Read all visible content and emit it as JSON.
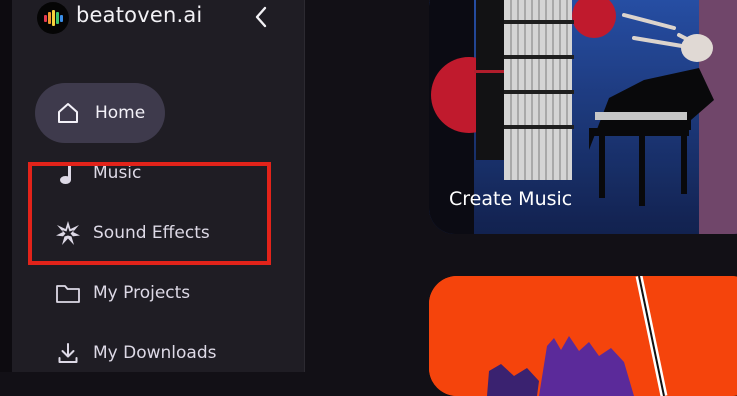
{
  "brand": {
    "name": "beatoven.ai"
  },
  "sidebar": {
    "items": [
      {
        "label": "Home",
        "icon": "home-icon",
        "active": true
      },
      {
        "label": "Music",
        "icon": "music-note-icon"
      },
      {
        "label": "Sound Effects",
        "icon": "burst-icon"
      },
      {
        "label": "My Projects",
        "icon": "folder-icon"
      },
      {
        "label": "My Downloads",
        "icon": "download-icon"
      }
    ]
  },
  "cards": [
    {
      "title": "Create Music"
    },
    {
      "title": ""
    }
  ],
  "colors": {
    "sidebar_bg": "#1f1d24",
    "active_pill": "#3e3a4c",
    "highlight": "#e2231a",
    "page_bg": "#121016"
  }
}
